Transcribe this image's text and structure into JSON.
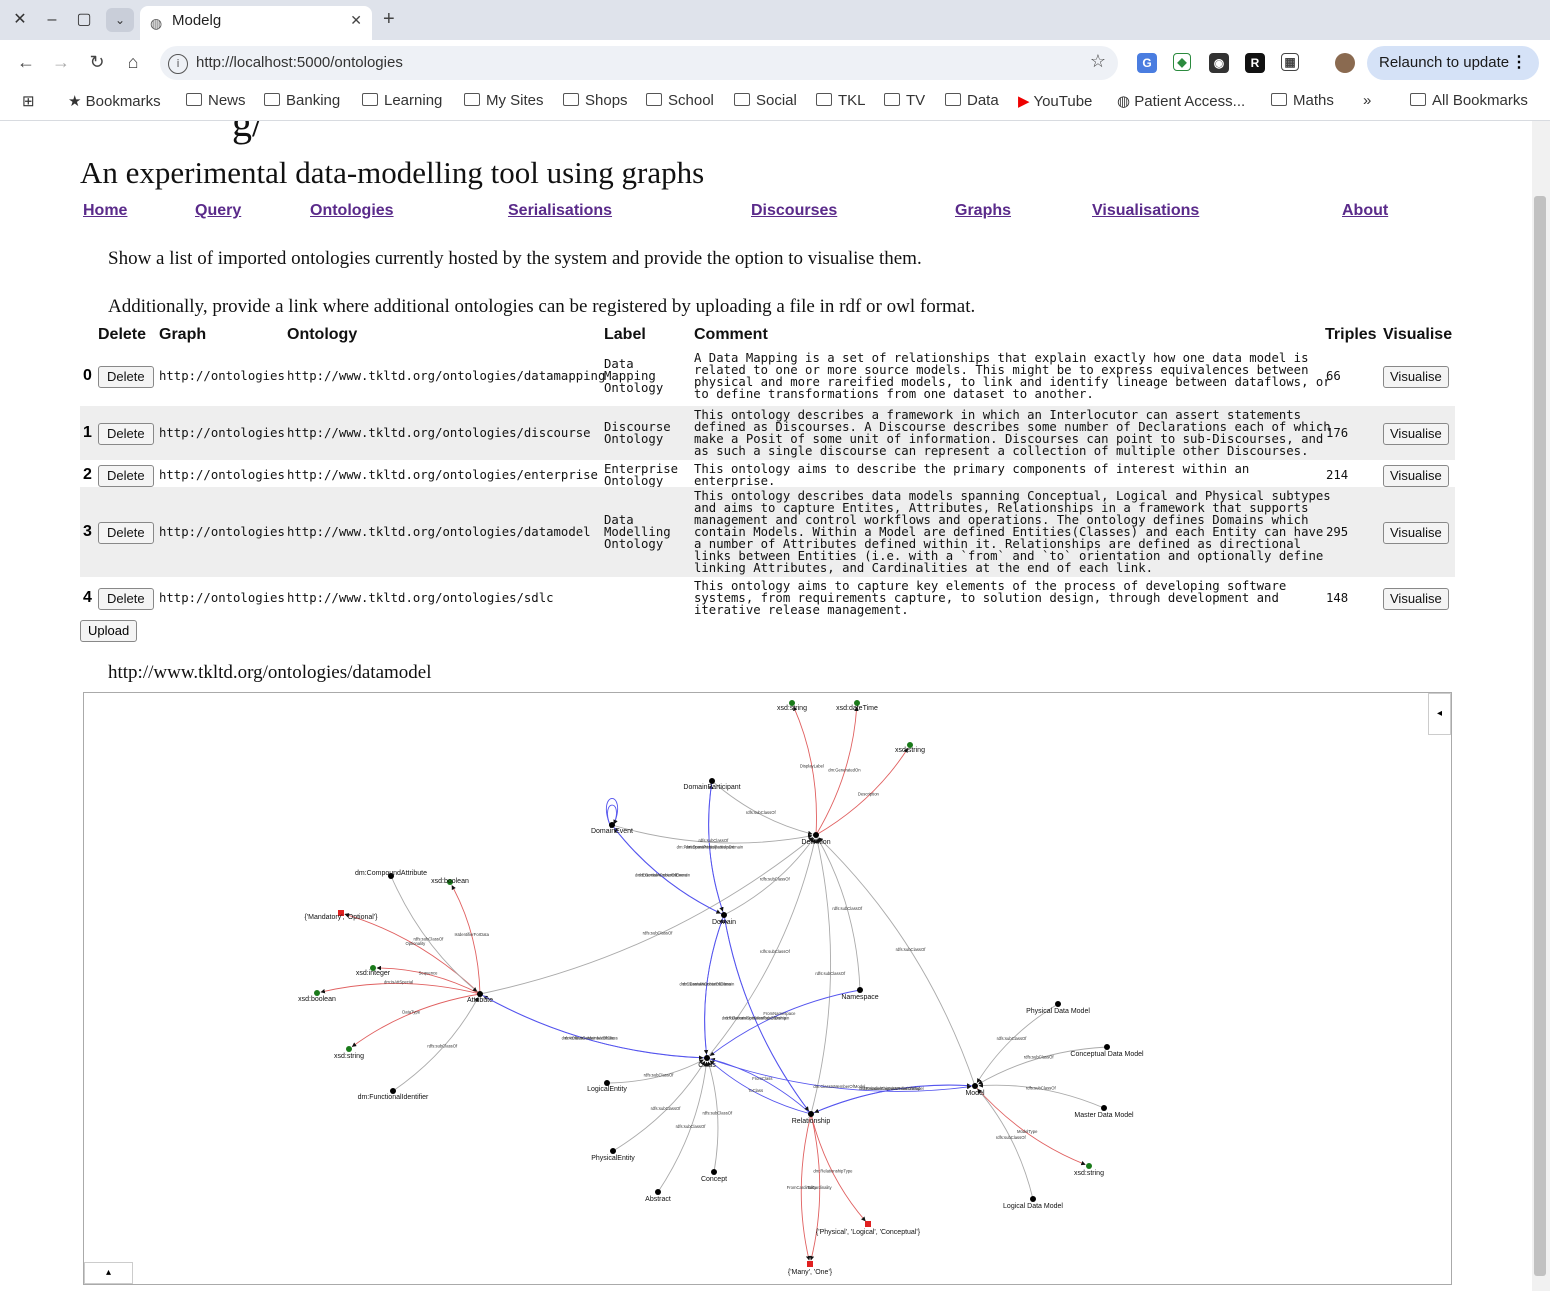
{
  "browser": {
    "tab_title": "Modelg",
    "url": "http://localhost:5000/ontologies",
    "relaunch_label": "Relaunch to update",
    "bookmarks": [
      "Bookmarks",
      "News",
      "Banking",
      "Learning",
      "My Sites",
      "Shops",
      "School",
      "Social",
      "TKL",
      "TV",
      "Data",
      "YouTube",
      "Patient Access...",
      "Maths"
    ],
    "overflow_label": "»",
    "all_bookmarks": "All Bookmarks"
  },
  "page": {
    "subtitle": "An experimental data-modelling tool using graphs",
    "nav": [
      "Home",
      "Query",
      "Ontologies",
      "Serialisations",
      "Discourses",
      "Graphs",
      "Visualisations",
      "About"
    ],
    "intro1": "Show a list of imported ontologies currently hosted by the system and provide the option to visualise them.",
    "intro2": "Additionally, provide a link where additional ontologies can be registered by uploading a file in rdf or owl format.",
    "table_headers": [
      "Delete",
      "Graph",
      "Ontology",
      "Label",
      "Comment",
      "Triples",
      "Visualise"
    ],
    "delete_label": "Delete",
    "visualise_label": "Visualise",
    "upload_label": "Upload",
    "rows": [
      {
        "idx": "0",
        "graph": "http://ontologies",
        "ontology": "http://www.tkltd.org/ontologies/datamapping",
        "label": [
          "Data",
          "Mapping",
          "Ontology"
        ],
        "comment": [
          "A Data Mapping is a set of relationships that explain exactly how one data model is",
          "related to one or more source models. This might be to express equivalences between",
          "physical and more rareified models, to link and identify lineage between dataflows, or",
          "to define transformations from one dataset to another."
        ],
        "triples": "66"
      },
      {
        "idx": "1",
        "graph": "http://ontologies",
        "ontology": "http://www.tkltd.org/ontologies/discourse",
        "label": [
          "Discourse",
          "Ontology"
        ],
        "comment": [
          "This ontology describes a framework in which an Interlocutor can assert statements",
          "defined as Discourses. A Discourse describes some number of Declarations each of which",
          "make a Posit of some unit of information. Discourses can point to sub-Discourses, and",
          "as such a single discourse can represent a collection of multiple other Discourses."
        ],
        "triples": "176"
      },
      {
        "idx": "2",
        "graph": "http://ontologies",
        "ontology": "http://www.tkltd.org/ontologies/enterprise",
        "label": [
          "Enterprise",
          "Ontology"
        ],
        "comment": [
          "This ontology aims to describe the primary components of interest within an",
          "enterprise."
        ],
        "triples": "214"
      },
      {
        "idx": "3",
        "graph": "http://ontologies",
        "ontology": "http://www.tkltd.org/ontologies/datamodel",
        "label": [
          "Data",
          "Modelling",
          "Ontology"
        ],
        "comment": [
          "This ontology describes data models spanning Conceptual, Logical and Physical subtypes",
          "and aims to capture Entites, Attributes, Relationships in a framework that supports",
          "management and control workflows and operations. The ontology defines Domains which",
          "contain Models. Within a Model are defined Entities(Classes) and each Entity can have",
          "a number of Attributes defined within it. Relationships are defined as directional",
          "links between Entities (i.e. with a `from` and `to` orientation and optionally define",
          "linking Attributes, and Cardinalities at the end of each link."
        ],
        "triples": "295"
      },
      {
        "idx": "4",
        "graph": "http://ontologies",
        "ontology": "http://www.tkltd.org/ontologies/sdlc",
        "label": [],
        "comment": [
          "This ontology aims to capture key elements of the process of developing software",
          "systems, from requirements capture, to solution design, through development and",
          "iterative release management."
        ],
        "triples": "148"
      }
    ],
    "graph_title": "http://www.tkltd.org/ontologies/datamodel",
    "panel_toggle_right": "◂",
    "panel_toggle_bottom": "▴"
  },
  "graph": {
    "colors": {
      "class": "#000000",
      "literal": "#1a7a1a",
      "enum": "#e02020",
      "subclass": "#aaaaaa",
      "object": "#5555ee",
      "datatype": "#e06060"
    },
    "nodes": [
      {
        "id": "xsdstr1",
        "label": "xsd:string",
        "kind": "literal"
      },
      {
        "id": "xsddt",
        "label": "xsd:dateTime",
        "kind": "literal"
      },
      {
        "id": "xsdstr2",
        "label": "xsd:string",
        "kind": "literal"
      },
      {
        "id": "dp",
        "label": "DomainParticipant",
        "kind": "class"
      },
      {
        "id": "de",
        "label": "DomainEvent",
        "kind": "class"
      },
      {
        "id": "def",
        "label": "Definition",
        "kind": "class"
      },
      {
        "id": "ca",
        "label": "dm:CompoundAttribute",
        "kind": "class"
      },
      {
        "id": "xsdbool1",
        "label": "xsd:boolean",
        "kind": "literal"
      },
      {
        "id": "mo",
        "label": "{'Mandatory', 'Optional'}",
        "kind": "enum"
      },
      {
        "id": "dom",
        "label": "Domain",
        "kind": "class"
      },
      {
        "id": "xsdint",
        "label": "xsd:integer",
        "kind": "literal"
      },
      {
        "id": "xsdbool2",
        "label": "xsd:boolean",
        "kind": "literal"
      },
      {
        "id": "attr",
        "label": "Attribute",
        "kind": "class"
      },
      {
        "id": "ns",
        "label": "Namespace",
        "kind": "class"
      },
      {
        "id": "pdm",
        "label": "Physical Data Model",
        "kind": "class"
      },
      {
        "id": "xsdstr3",
        "label": "xsd:string",
        "kind": "literal"
      },
      {
        "id": "cdm",
        "label": "Conceptual Data Model",
        "kind": "class"
      },
      {
        "id": "cls",
        "label": "Class",
        "kind": "class"
      },
      {
        "id": "le",
        "label": "LogicalEntity",
        "kind": "class"
      },
      {
        "id": "fi",
        "label": "dm:FunctionalIdentifier",
        "kind": "class"
      },
      {
        "id": "model",
        "label": "Model",
        "kind": "class"
      },
      {
        "id": "mdm",
        "label": "Master Data Model",
        "kind": "class"
      },
      {
        "id": "rel",
        "label": "Relationship",
        "kind": "class"
      },
      {
        "id": "pe",
        "label": "PhysicalEntity",
        "kind": "class"
      },
      {
        "id": "xsdstr4",
        "label": "xsd:string",
        "kind": "literal"
      },
      {
        "id": "con",
        "label": "Concept",
        "kind": "class"
      },
      {
        "id": "abs",
        "label": "Abstract",
        "kind": "class"
      },
      {
        "id": "ldm",
        "label": "Logical Data Model",
        "kind": "class"
      },
      {
        "id": "plc",
        "label": "{'Physical', 'Logical', 'Conceptual'}",
        "kind": "enum"
      },
      {
        "id": "mone",
        "label": "{'Many', 'One'}",
        "kind": "enum"
      }
    ],
    "edges": [
      {
        "from": "def",
        "to": "xsdstr1",
        "kind": "datatype",
        "label": "DisplayLabel"
      },
      {
        "from": "def",
        "to": "xsddt",
        "kind": "datatype",
        "label": "dm:GeneratedOn"
      },
      {
        "from": "def",
        "to": "xsdstr2",
        "kind": "datatype",
        "label": "Description"
      },
      {
        "from": "dp",
        "to": "def",
        "kind": "subclass",
        "label": "rdfs:subClassOf"
      },
      {
        "from": "de",
        "to": "def",
        "kind": "subclass",
        "label": "rdfs:subClassOf"
      },
      {
        "from": "de",
        "to": "de",
        "kind": "object",
        "label": "dm:Succeeds"
      },
      {
        "from": "de",
        "to": "de",
        "kind": "object",
        "label": "dm:Precedes"
      },
      {
        "from": "dp",
        "to": "dom",
        "kind": "object",
        "label": "dm:ParticipantParticipatesInDomain"
      },
      {
        "from": "dom",
        "to": "dp",
        "kind": "object",
        "label": "dm:DomainHasParticipant"
      },
      {
        "from": "de",
        "to": "dom",
        "kind": "object",
        "label": "dm:EventIsMemberOfDomain"
      },
      {
        "from": "dom",
        "to": "de",
        "kind": "object",
        "label": "dm:DomainContainsEvent"
      },
      {
        "from": "dom",
        "to": "def",
        "kind": "subclass",
        "label": "rdfs:subClassOf"
      },
      {
        "from": "attr",
        "to": "def",
        "kind": "subclass",
        "label": "rdfs:subClassOf"
      },
      {
        "from": "ca",
        "to": "attr",
        "kind": "subclass",
        "label": "rdfs:subClassOf"
      },
      {
        "from": "attr",
        "to": "xsdbool1",
        "kind": "datatype",
        "label": "IsIdentifierForData"
      },
      {
        "from": "attr",
        "to": "mo",
        "kind": "datatype",
        "label": "Optionality"
      },
      {
        "from": "attr",
        "to": "xsdint",
        "kind": "datatype",
        "label": "Sequence"
      },
      {
        "from": "attr",
        "to": "xsdbool2",
        "kind": "datatype",
        "label": "dm:IsAttSpecial"
      },
      {
        "from": "attr",
        "to": "xsdstr4b",
        "kind": "datatype",
        "label": "DataType"
      },
      {
        "from": "fi",
        "to": "attr",
        "kind": "subclass",
        "label": "rdfs:subClassOf"
      },
      {
        "from": "attr",
        "to": "cls",
        "kind": "object",
        "label": "dm:AttributeIsMemberOfClass"
      },
      {
        "from": "cls",
        "to": "attr",
        "kind": "object",
        "label": "dm:ClassContainsAttribute"
      },
      {
        "from": "dom",
        "to": "cls",
        "kind": "object",
        "label": "dm:DomainContainsClass"
      },
      {
        "from": "cls",
        "to": "dom",
        "kind": "object",
        "label": "dm:ClassIsMemberOfDomain"
      },
      {
        "from": "dom",
        "to": "rel",
        "kind": "object",
        "label": "dm:DomainContainsRelationship"
      },
      {
        "from": "rel",
        "to": "dom",
        "kind": "object",
        "label": "dm:RelationshipIsMemberOfDomain"
      },
      {
        "from": "cls",
        "to": "def",
        "kind": "subclass",
        "label": "rdfs:subClassOf"
      },
      {
        "from": "ns",
        "to": "def",
        "kind": "subclass",
        "label": "rdfs:subClassOf"
      },
      {
        "from": "ns",
        "to": "cls",
        "kind": "object",
        "label": "FromNamespace"
      },
      {
        "from": "model",
        "to": "def",
        "kind": "subclass",
        "label": "rdfs:subClassOf"
      },
      {
        "from": "cls",
        "to": "model",
        "kind": "object",
        "label": "dm:ClassIsMemberOfModel"
      },
      {
        "from": "model",
        "to": "rel",
        "kind": "object",
        "label": "dm:ModelContainsRelationship"
      },
      {
        "from": "rel",
        "to": "model",
        "kind": "object",
        "label": "dm:RelationshipIsMemberOfModel"
      },
      {
        "from": "pdm",
        "to": "model",
        "kind": "subclass",
        "label": "rdfs:subClassOf"
      },
      {
        "from": "cdm",
        "to": "model",
        "kind": "subclass",
        "label": "rdfs:subClassOf"
      },
      {
        "from": "mdm",
        "to": "model",
        "kind": "subclass",
        "label": "rdfs:subClassOf"
      },
      {
        "from": "ldm",
        "to": "model",
        "kind": "subclass",
        "label": "rdfs:subClassOf"
      },
      {
        "from": "model",
        "to": "xsdstr3",
        "kind": "datatype",
        "label": "ModelType"
      },
      {
        "from": "le",
        "to": "cls",
        "kind": "subclass",
        "label": "rdfs:subClassOf"
      },
      {
        "from": "pe",
        "to": "cls",
        "kind": "subclass",
        "label": "rdfs:subClassOf"
      },
      {
        "from": "abs",
        "to": "cls",
        "kind": "subclass",
        "label": "rdfs:subClassOf"
      },
      {
        "from": "con",
        "to": "cls",
        "kind": "subclass",
        "label": "rdfs:subClassOf"
      },
      {
        "from": "rel",
        "to": "cls",
        "kind": "object",
        "label": "FromClass"
      },
      {
        "from": "rel",
        "to": "cls",
        "kind": "object",
        "label": "ToClass"
      },
      {
        "from": "rel",
        "to": "def",
        "kind": "subclass",
        "label": "rdfs:subClassOf"
      },
      {
        "from": "rel",
        "to": "plc",
        "kind": "datatype",
        "label": "dm:RelationshipType"
      },
      {
        "from": "rel",
        "to": "mone",
        "kind": "datatype",
        "label": "FromCardinality"
      },
      {
        "from": "rel",
        "to": "mone",
        "kind": "datatype",
        "label": "ToCardinality"
      }
    ]
  }
}
